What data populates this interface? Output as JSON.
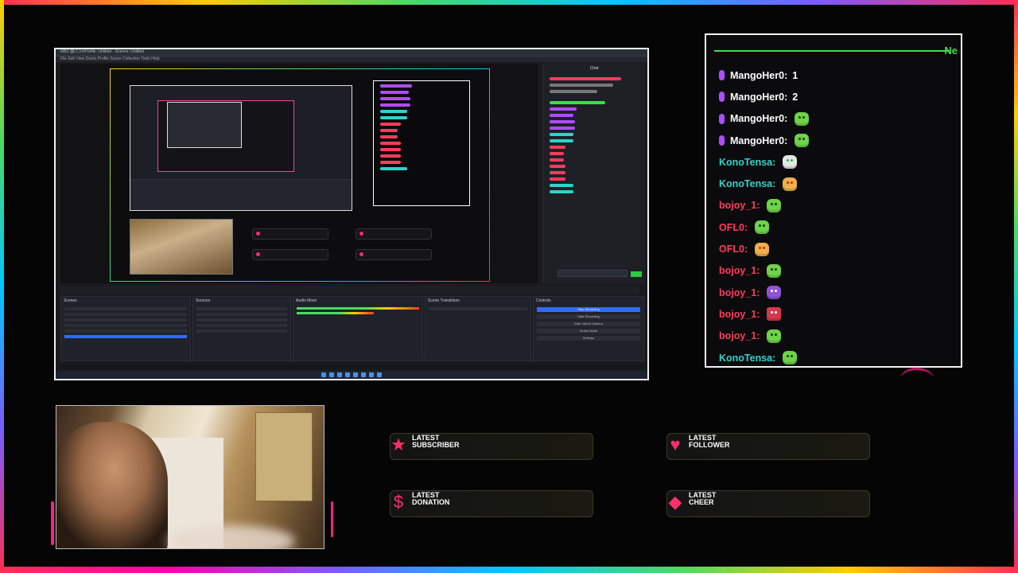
{
  "capture": {
    "title": "OBS 30.2.3 - Profile: Untitled - Scenes: Untitled",
    "menu": "File  Edit  View  Docks  Profile  Scene Collection  Tools  Help",
    "chat_dock_title": "Chat",
    "window_controls": "– ▢ ✕",
    "docks": [
      "Scenes",
      "Sources",
      "Audio Mixer",
      "Scene Transitions",
      "Controls"
    ],
    "controls": [
      "Stop Streaming",
      "Start Recording",
      "Start Virtual Camera",
      "Studio Mode",
      "Settings"
    ]
  },
  "chat": {
    "header": "Ne",
    "colors": {
      "accent": "#3ddc4a",
      "mango": "#ffffff",
      "kono": "#2ed3c9",
      "bojoy": "#ff3b5c",
      "ofl": "#ff3b5c"
    },
    "messages": [
      {
        "user": "MangoHer0:",
        "text": "1",
        "badge": true,
        "color": "#ffffff",
        "emote": ""
      },
      {
        "user": "MangoHer0:",
        "text": "2",
        "badge": true,
        "color": "#ffffff",
        "emote": ""
      },
      {
        "user": "MangoHer0:",
        "text": "",
        "badge": true,
        "color": "#ffffff",
        "emote": "green"
      },
      {
        "user": "MangoHer0:",
        "text": "",
        "badge": true,
        "color": "#ffffff",
        "emote": "green"
      },
      {
        "user": "KonoTensa:",
        "text": "",
        "badge": false,
        "color": "#2ed3c9",
        "emote": "robot"
      },
      {
        "user": "KonoTensa:",
        "text": "",
        "badge": false,
        "color": "#2ed3c9",
        "emote": "face"
      },
      {
        "user": "bojoy_1:",
        "text": "",
        "badge": false,
        "color": "#ff3b5c",
        "emote": "green"
      },
      {
        "user": "OFL0:",
        "text": "",
        "badge": false,
        "color": "#ff3b5c",
        "emote": "green"
      },
      {
        "user": "OFL0:",
        "text": "",
        "badge": false,
        "color": "#ff3b5c",
        "emote": "face"
      },
      {
        "user": "bojoy_1:",
        "text": "",
        "badge": false,
        "color": "#ff3b5c",
        "emote": "green"
      },
      {
        "user": "bojoy_1:",
        "text": "",
        "badge": false,
        "color": "#ff3b5c",
        "emote": "grape"
      },
      {
        "user": "bojoy_1:",
        "text": "",
        "badge": false,
        "color": "#ff3b5c",
        "emote": "box"
      },
      {
        "user": "bojoy_1:",
        "text": "",
        "badge": false,
        "color": "#ff3b5c",
        "emote": "green"
      },
      {
        "user": "KonoTensa:",
        "text": "",
        "badge": false,
        "color": "#2ed3c9",
        "emote": "green"
      }
    ]
  },
  "alerts": {
    "subscriber": {
      "line1": "LATEST",
      "line2": "SUBSCRIBER",
      "icon": "star-icon"
    },
    "follower": {
      "line1": "LATEST",
      "line2": "FOLLOWER",
      "icon": "heart-icon"
    },
    "donation": {
      "line1": "LATEST",
      "line2": "DONATION",
      "icon": "dollar-icon"
    },
    "cheer": {
      "line1": "LATEST",
      "line2": "CHEER",
      "icon": "diamond-icon"
    }
  }
}
